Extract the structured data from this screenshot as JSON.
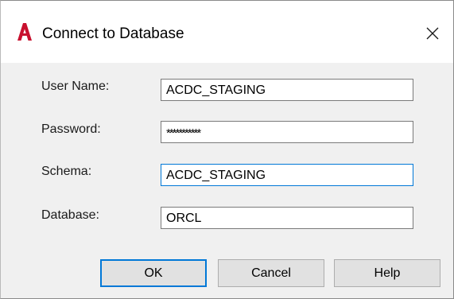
{
  "window": {
    "title": "Connect to Database",
    "icon": "autocad-a-icon",
    "close_icon": "close-x-icon",
    "accent_color": "#0078d7",
    "brand_color": "#c8102e"
  },
  "form": {
    "username_label": "User Name:",
    "username_value": "ACDC_STAGING",
    "password_label": "Password:",
    "password_value": "***********",
    "schema_label": "Schema:",
    "schema_value": "ACDC_STAGING",
    "database_label": "Database:",
    "database_value": "ORCL"
  },
  "buttons": {
    "ok_label": "OK",
    "cancel_label": "Cancel",
    "help_label": "Help"
  }
}
